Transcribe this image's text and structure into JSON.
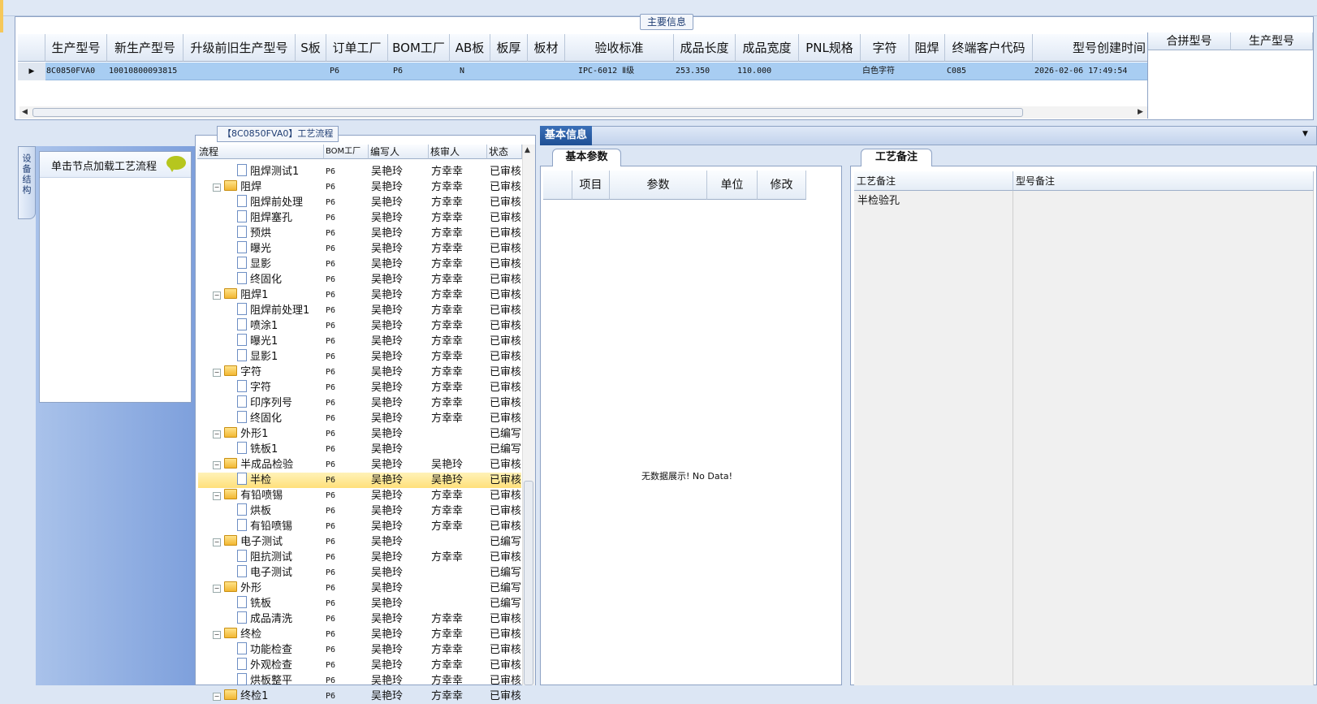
{
  "main": {
    "legend": "主要信息",
    "columns": [
      "生产型号",
      "新生产型号",
      "升级前旧生产型号",
      "S板",
      "订单工厂",
      "BOM工厂",
      "AB板",
      "板厚",
      "板材",
      "验收标准",
      "成品长度",
      "成品宽度",
      "PNL规格",
      "字符",
      "阻焊",
      "终端客户代码",
      "型号创建时间"
    ],
    "row": {
      "prod_model": "8C0850FVA0",
      "new_model": "10010800093815",
      "old_model": "",
      "s_board": "",
      "order_factory": "P6",
      "bom_factory": "P6",
      "ab_board": "N",
      "thickness": "",
      "material": "",
      "standard": "IPC-6012 Ⅱ级",
      "length": "253.350",
      "width": "110.000",
      "pnl": "",
      "char": "白色字符",
      "solder": "",
      "customer": "C085",
      "created": "2026-02-06 17:49:54"
    },
    "merge_columns": [
      "合拼型号",
      "生产型号"
    ]
  },
  "side": {
    "tab_label": "设备结构",
    "hint": "单击节点加载工艺流程"
  },
  "flow": {
    "legend": "【8C0850FVA0】工艺流程",
    "columns": [
      "流程",
      "BOM工厂",
      "编写人",
      "核审人",
      "状态"
    ],
    "rows": [
      {
        "name": "阻焊测试1",
        "level": 2,
        "folder": false,
        "bom": "P6",
        "writer": "吴艳玲",
        "reviewer": "方幸幸",
        "status": "已审核"
      },
      {
        "name": "阻焊",
        "level": 1,
        "folder": true,
        "bom": "P6",
        "writer": "吴艳玲",
        "reviewer": "方幸幸",
        "status": "已审核"
      },
      {
        "name": "阻焊前处理",
        "level": 2,
        "folder": false,
        "bom": "P6",
        "writer": "吴艳玲",
        "reviewer": "方幸幸",
        "status": "已审核"
      },
      {
        "name": "阻焊塞孔",
        "level": 2,
        "folder": false,
        "bom": "P6",
        "writer": "吴艳玲",
        "reviewer": "方幸幸",
        "status": "已审核"
      },
      {
        "name": "预烘",
        "level": 2,
        "folder": false,
        "bom": "P6",
        "writer": "吴艳玲",
        "reviewer": "方幸幸",
        "status": "已审核"
      },
      {
        "name": "曝光",
        "level": 2,
        "folder": false,
        "bom": "P6",
        "writer": "吴艳玲",
        "reviewer": "方幸幸",
        "status": "已审核"
      },
      {
        "name": "显影",
        "level": 2,
        "folder": false,
        "bom": "P6",
        "writer": "吴艳玲",
        "reviewer": "方幸幸",
        "status": "已审核"
      },
      {
        "name": "终固化",
        "level": 2,
        "folder": false,
        "bom": "P6",
        "writer": "吴艳玲",
        "reviewer": "方幸幸",
        "status": "已审核"
      },
      {
        "name": "阻焊1",
        "level": 1,
        "folder": true,
        "bom": "P6",
        "writer": "吴艳玲",
        "reviewer": "方幸幸",
        "status": "已审核"
      },
      {
        "name": "阻焊前处理1",
        "level": 2,
        "folder": false,
        "bom": "P6",
        "writer": "吴艳玲",
        "reviewer": "方幸幸",
        "status": "已审核"
      },
      {
        "name": "喷涂1",
        "level": 2,
        "folder": false,
        "bom": "P6",
        "writer": "吴艳玲",
        "reviewer": "方幸幸",
        "status": "已审核"
      },
      {
        "name": "曝光1",
        "level": 2,
        "folder": false,
        "bom": "P6",
        "writer": "吴艳玲",
        "reviewer": "方幸幸",
        "status": "已审核"
      },
      {
        "name": "显影1",
        "level": 2,
        "folder": false,
        "bom": "P6",
        "writer": "吴艳玲",
        "reviewer": "方幸幸",
        "status": "已审核"
      },
      {
        "name": "字符",
        "level": 1,
        "folder": true,
        "bom": "P6",
        "writer": "吴艳玲",
        "reviewer": "方幸幸",
        "status": "已审核"
      },
      {
        "name": "字符",
        "level": 2,
        "folder": false,
        "bom": "P6",
        "writer": "吴艳玲",
        "reviewer": "方幸幸",
        "status": "已审核"
      },
      {
        "name": "印序列号",
        "level": 2,
        "folder": false,
        "bom": "P6",
        "writer": "吴艳玲",
        "reviewer": "方幸幸",
        "status": "已审核"
      },
      {
        "name": "终固化",
        "level": 2,
        "folder": false,
        "bom": "P6",
        "writer": "吴艳玲",
        "reviewer": "方幸幸",
        "status": "已审核"
      },
      {
        "name": "外形1",
        "level": 1,
        "folder": true,
        "bom": "P6",
        "writer": "吴艳玲",
        "reviewer": "",
        "status": "已编写"
      },
      {
        "name": "铣板1",
        "level": 2,
        "folder": false,
        "bom": "P6",
        "writer": "吴艳玲",
        "reviewer": "",
        "status": "已编写"
      },
      {
        "name": "半成品检验",
        "level": 1,
        "folder": true,
        "bom": "P6",
        "writer": "吴艳玲",
        "reviewer": "吴艳玲",
        "status": "已审核"
      },
      {
        "name": "半检",
        "level": 2,
        "folder": false,
        "bom": "P6",
        "writer": "吴艳玲",
        "reviewer": "吴艳玲",
        "status": "已审核",
        "selected": true
      },
      {
        "name": "有铅喷锡",
        "level": 1,
        "folder": true,
        "bom": "P6",
        "writer": "吴艳玲",
        "reviewer": "方幸幸",
        "status": "已审核"
      },
      {
        "name": "烘板",
        "level": 2,
        "folder": false,
        "bom": "P6",
        "writer": "吴艳玲",
        "reviewer": "方幸幸",
        "status": "已审核"
      },
      {
        "name": "有铅喷锡",
        "level": 2,
        "folder": false,
        "bom": "P6",
        "writer": "吴艳玲",
        "reviewer": "方幸幸",
        "status": "已审核"
      },
      {
        "name": "电子测试",
        "level": 1,
        "folder": true,
        "bom": "P6",
        "writer": "吴艳玲",
        "reviewer": "",
        "status": "已编写"
      },
      {
        "name": "阻抗测试",
        "level": 2,
        "folder": false,
        "bom": "P6",
        "writer": "吴艳玲",
        "reviewer": "方幸幸",
        "status": "已审核"
      },
      {
        "name": "电子测试",
        "level": 2,
        "folder": false,
        "bom": "P6",
        "writer": "吴艳玲",
        "reviewer": "",
        "status": "已编写"
      },
      {
        "name": "外形",
        "level": 1,
        "folder": true,
        "bom": "P6",
        "writer": "吴艳玲",
        "reviewer": "",
        "status": "已编写"
      },
      {
        "name": "铣板",
        "level": 2,
        "folder": false,
        "bom": "P6",
        "writer": "吴艳玲",
        "reviewer": "",
        "status": "已编写"
      },
      {
        "name": "成品清洗",
        "level": 2,
        "folder": false,
        "bom": "P6",
        "writer": "吴艳玲",
        "reviewer": "方幸幸",
        "status": "已审核"
      },
      {
        "name": "终检",
        "level": 1,
        "folder": true,
        "bom": "P6",
        "writer": "吴艳玲",
        "reviewer": "方幸幸",
        "status": "已审核"
      },
      {
        "name": "功能检查",
        "level": 2,
        "folder": false,
        "bom": "P6",
        "writer": "吴艳玲",
        "reviewer": "方幸幸",
        "status": "已审核"
      },
      {
        "name": "外观检查",
        "level": 2,
        "folder": false,
        "bom": "P6",
        "writer": "吴艳玲",
        "reviewer": "方幸幸",
        "status": "已审核"
      },
      {
        "name": "烘板整平",
        "level": 2,
        "folder": false,
        "bom": "P6",
        "writer": "吴艳玲",
        "reviewer": "方幸幸",
        "status": "已审核"
      },
      {
        "name": "终检1",
        "level": 1,
        "folder": true,
        "bom": "P6",
        "writer": "吴艳玲",
        "reviewer": "方幸幸",
        "status": "已审核"
      }
    ]
  },
  "base": {
    "tab": "基本信息",
    "param_tab": "基本参数",
    "param_columns": [
      "项目",
      "参数",
      "单位",
      "修改"
    ],
    "nodata": "无数据展示! No Data!",
    "remark_tab": "工艺备注",
    "remark_columns": [
      "工艺备注",
      "型号备注"
    ],
    "process_remark": "半检验孔"
  }
}
